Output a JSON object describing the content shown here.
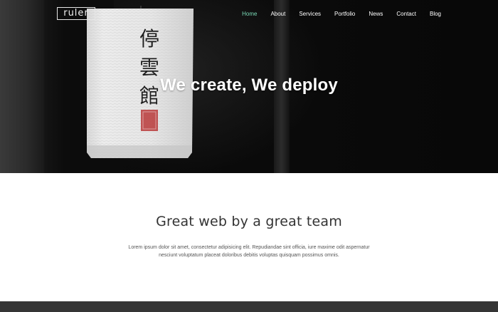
{
  "brand": {
    "logo_text": "ruler"
  },
  "nav": {
    "items": [
      {
        "label": "Home",
        "active": true
      },
      {
        "label": "About"
      },
      {
        "label": "Services"
      },
      {
        "label": "Portfolio"
      },
      {
        "label": "News"
      },
      {
        "label": "Contact"
      },
      {
        "label": "Blog"
      }
    ],
    "active_color": "#7ad9b6"
  },
  "hero": {
    "title": "We create, We deploy",
    "lantern_chars": [
      "停",
      "雲",
      "館"
    ]
  },
  "about": {
    "heading": "Great web by a great team",
    "body": "Lorem ipsum dolor sit amet, consectetur adipisicing elit. Repudiandae sint officia, iure maxime odit aspernatur nesciunt voluptatum placeat doloribus debitis voluptas quisquam possimus omnis."
  },
  "colors": {
    "footer_band": "#353535",
    "heading_text": "#333333"
  }
}
